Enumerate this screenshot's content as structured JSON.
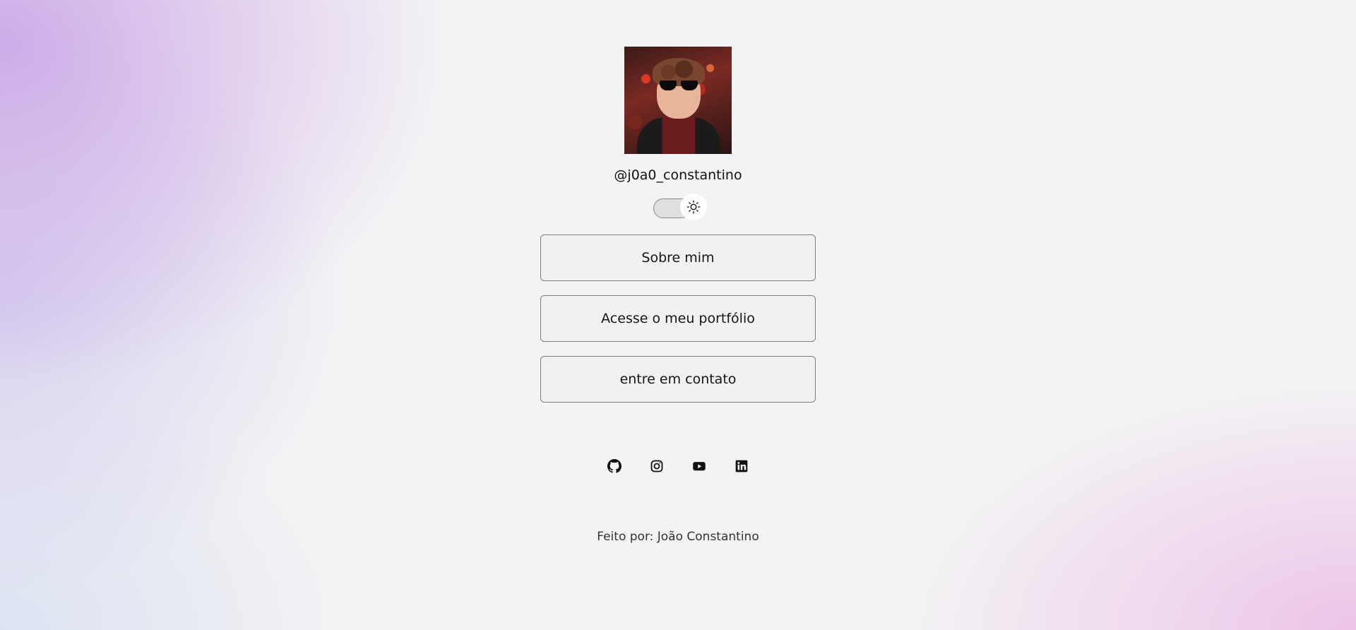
{
  "profile": {
    "handle": "@j0a0_constantino"
  },
  "theme_toggle": {
    "icon": "sun-icon",
    "state": "light"
  },
  "links": [
    {
      "label": "Sobre mim"
    },
    {
      "label": "Acesse o meu portfólio"
    },
    {
      "label": "entre em contato"
    }
  ],
  "socials": [
    {
      "icon": "github-icon"
    },
    {
      "icon": "instagram-icon"
    },
    {
      "icon": "youtube-icon"
    },
    {
      "icon": "linkedin-icon"
    }
  ],
  "footer": {
    "text": "Feito por: João Constantino"
  },
  "colors": {
    "gradient_left": "#c8a0e6",
    "gradient_bottom_right": "#ebb9e6",
    "background": "#f3f2f4",
    "button_border": "#7d7d80",
    "text": "#111111"
  }
}
